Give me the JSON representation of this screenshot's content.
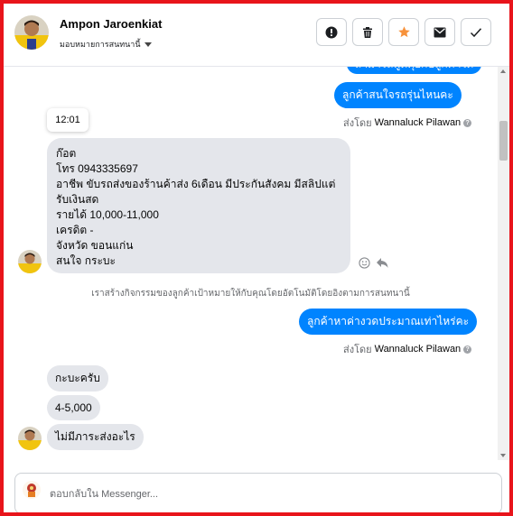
{
  "header": {
    "contact_name": "Ampon Jaroenkiat",
    "assign_label": "มอบหมายการสนทนานี้",
    "actions": [
      {
        "name": "report",
        "icon": "exclamation-icon"
      },
      {
        "name": "delete",
        "icon": "trash-icon"
      },
      {
        "name": "star",
        "icon": "star-icon"
      },
      {
        "name": "mark-unread",
        "icon": "envelope-icon"
      },
      {
        "name": "mark-done",
        "icon": "check-icon"
      }
    ]
  },
  "colors": {
    "accent": "#0084ff",
    "star": "#f7923b",
    "frame": "#e8141b",
    "incoming_bubble": "#e4e6eb"
  },
  "messages": {
    "out_partial": "สามารถพูดคุยกับลูกค้าได้",
    "out_1": "ลูกค้าสนใจรถรุ่นไหนคะ",
    "sent_by_prefix_1": "ส่งโดย",
    "sender_1": "Wannaluck Pilawan",
    "timestamp": "12:01",
    "in_long_lines": [
      "ก๊อต",
      "โทร 0943335697",
      "อาชีพ ขับรถส่งของร้านค้าส่ง 6เดือน มีประกันสังคม มีสลิปแต่",
      "รับเงินสด",
      "รายได้  10,000-11,000",
      "เครดิต -",
      "จังหวัด ขอนแก่น",
      "สนใจ กระบะ"
    ],
    "system_notice": "เราสร้างกิจกรรมของลูกค้าเป้าหมายให้กับคุณโดยอัตโนมัติโดยอิงตามการสนทนานี้",
    "out_2": "ลูกค้าหาค่างวดประมาณเท่าไหร่คะ",
    "sent_by_prefix_2": "ส่งโดย",
    "sender_2": "Wannaluck Pilawan",
    "in_1": "กะบะครับ",
    "in_2": "4-5,000",
    "in_3": "ไม่มีภาระส่งอะไร"
  },
  "composer": {
    "placeholder": "ตอบกลับใน Messenger..."
  }
}
